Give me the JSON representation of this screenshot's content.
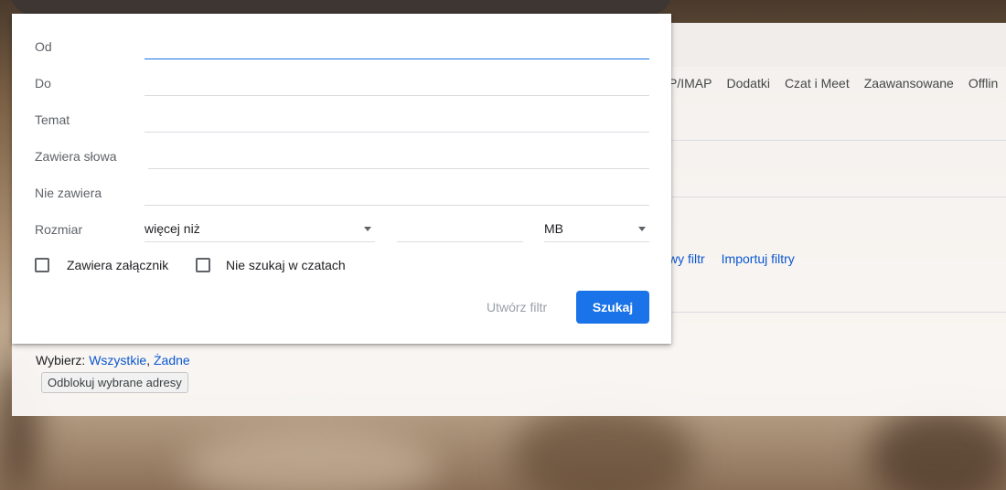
{
  "settings": {
    "tabs": [
      "P/IMAP",
      "Dodatki",
      "Czat i Meet",
      "Zaawansowane",
      "Offlin"
    ],
    "filter_links": [
      "wy filtr",
      "Importuj filtry"
    ],
    "select_label": "Wybierz:",
    "select_all": "Wszystkie",
    "select_comma": ",",
    "select_none": "Żadne",
    "unblock_button": "Odblokuj wybrane adresy"
  },
  "advanced_search": {
    "from_label": "Od",
    "to_label": "Do",
    "subject_label": "Temat",
    "has_words_label": "Zawiera słowa",
    "doesnt_have_label": "Nie zawiera",
    "size_label": "Rozmiar",
    "size_operator": "więcej niż",
    "size_value": "",
    "size_unit": "MB",
    "has_attachment_label": "Zawiera załącznik",
    "exclude_chats_label": "Nie szukaj w czatach",
    "create_filter_button": "Utwórz filtr",
    "search_button": "Szukaj"
  },
  "colors": {
    "accent": "#1a73e8",
    "link": "#0b57d0",
    "disabled_text": "#9aa0a6"
  }
}
